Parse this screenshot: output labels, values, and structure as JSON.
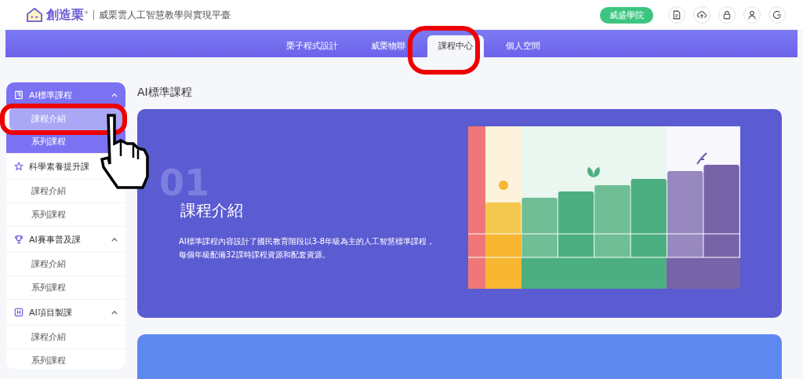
{
  "header": {
    "brand": "創造栗$^{®}$",
    "subtitle": "威栗雲人工智慧教學與實現平臺",
    "academy_button": "威盛學院"
  },
  "nav": {
    "tabs": [
      {
        "label": "栗子程式設計",
        "selected": false
      },
      {
        "label": "威栗物聯",
        "selected": false
      },
      {
        "label": "課程中心",
        "selected": true
      },
      {
        "label": "個人空間",
        "selected": false
      }
    ]
  },
  "sidebar": {
    "groups": [
      {
        "title": "AI標準課程",
        "expanded": true,
        "items": [
          {
            "label": "課程介紹",
            "selected": true
          },
          {
            "label": "系列課程",
            "selected": false
          }
        ]
      },
      {
        "title": "科學素養提升課",
        "expanded": true,
        "items": [
          {
            "label": "課程介紹",
            "selected": false
          },
          {
            "label": "系列課程",
            "selected": false
          }
        ]
      },
      {
        "title": "AI賽事普及課",
        "expanded": true,
        "items": [
          {
            "label": "課程介紹",
            "selected": false
          },
          {
            "label": "系列課程",
            "selected": false
          }
        ]
      },
      {
        "title": "AI項目製課",
        "expanded": true,
        "items": [
          {
            "label": "課程介紹",
            "selected": false
          },
          {
            "label": "系列課程",
            "selected": false
          }
        ]
      }
    ]
  },
  "main": {
    "title": "AI標準課程",
    "card": {
      "number": "01",
      "title": "課程介紹",
      "description_lines": [
        "AI標準課程內容設計了國民教育階段以3-8年級為主的人工智慧標準課程，",
        "每個年級配備32課時課程資源和配套資源。"
      ]
    }
  }
}
